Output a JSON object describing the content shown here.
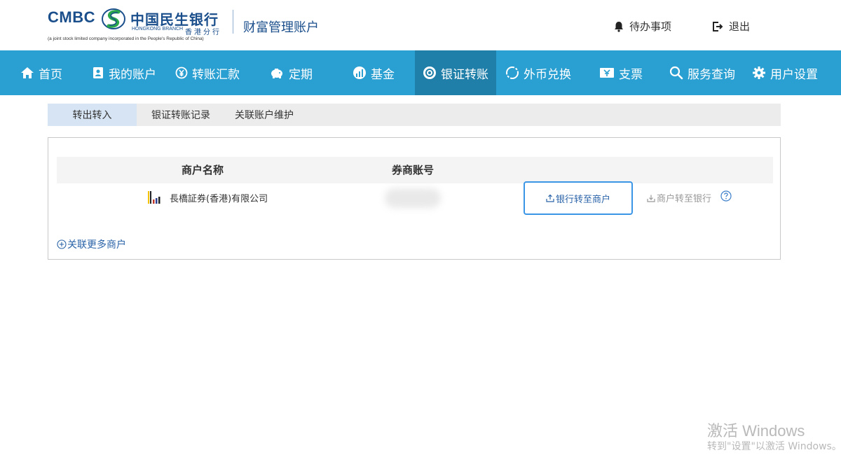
{
  "header": {
    "logo": {
      "cmbc": "CMBC",
      "bank_name_cn": "中国民生银行",
      "branch_en": "HONGKONG BRANCH",
      "branch_cn": "香港分行",
      "legal_note": "(a joint stock limited company incorporated in the People's Republic of China)"
    },
    "app_title": "财富管理账户",
    "todo_label": "待办事项",
    "logout_label": "退出"
  },
  "nav": {
    "items": [
      {
        "label": "首页",
        "icon": "home-icon"
      },
      {
        "label": "我的账户",
        "icon": "account-book-icon"
      },
      {
        "label": "转账汇款",
        "icon": "yuan-transfer-icon"
      },
      {
        "label": "定期",
        "icon": "piggy-bank-icon"
      },
      {
        "label": "基金",
        "icon": "fund-chart-icon"
      },
      {
        "label": "银证转账",
        "icon": "securities-transfer-icon",
        "active": true
      },
      {
        "label": "外币兑换",
        "icon": "exchange-icon"
      },
      {
        "label": "支票",
        "icon": "cheque-icon"
      },
      {
        "label": "服务查询",
        "icon": "search-icon"
      },
      {
        "label": "用户设置",
        "icon": "gear-icon"
      }
    ]
  },
  "subtabs": [
    {
      "label": "转出转入",
      "active": true
    },
    {
      "label": "银证转账记录"
    },
    {
      "label": "关联账户维护"
    }
  ],
  "table": {
    "headers": {
      "merchant_name": "商户名称",
      "broker_account": "券商账号"
    },
    "rows": [
      {
        "merchant": "長橋証券(香港)有限公司",
        "bank_to_merchant": "银行转至商户",
        "merchant_to_bank": "商户转至银行"
      }
    ]
  },
  "link_more": "关联更多商户",
  "watermark": {
    "line1": "激活 Windows",
    "line2": "转到\"设置\"以激活 Windows。"
  },
  "colors": {
    "nav_bg": "#2a9fd1",
    "nav_active": "#1f7fa8",
    "brand_blue": "#1b4f8c",
    "button_border": "#3b95e6"
  }
}
